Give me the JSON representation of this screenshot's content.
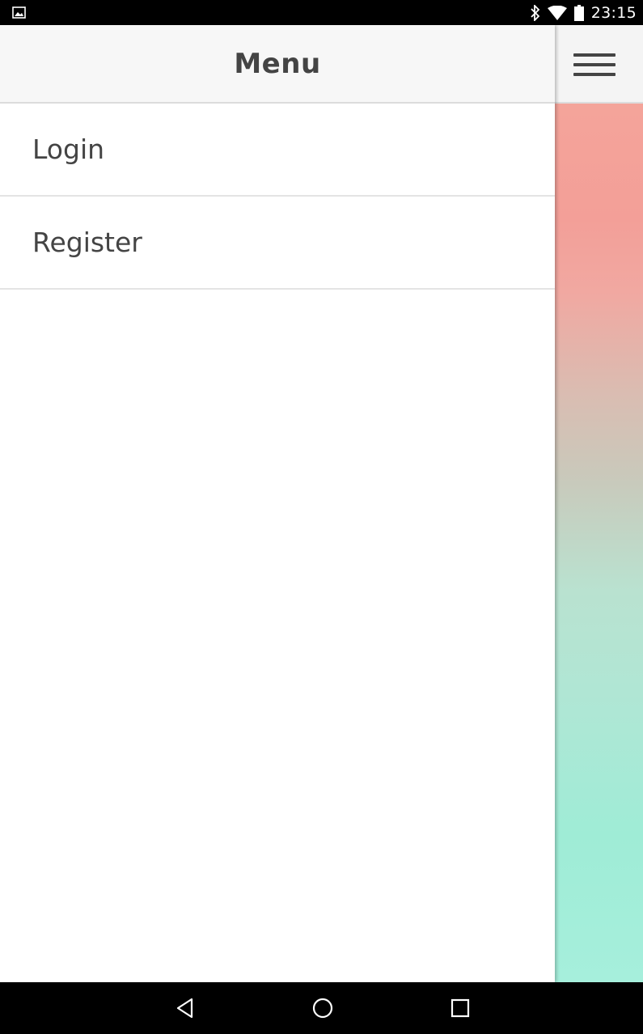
{
  "status_bar": {
    "time": "23:15",
    "icons": [
      "image-notification-icon",
      "bluetooth-icon",
      "wifi-icon",
      "battery-icon"
    ]
  },
  "drawer": {
    "title": "Menu",
    "items": [
      {
        "label": "Login"
      },
      {
        "label": "Register"
      }
    ]
  },
  "nav_bar": {
    "buttons": [
      "back-icon",
      "home-icon",
      "recents-icon"
    ]
  },
  "colors": {
    "drawer_bg": "#ffffff",
    "header_bg": "#f7f7f7",
    "text": "#444444",
    "background_top": "#f39f98",
    "background_bottom": "#a6efdc"
  }
}
